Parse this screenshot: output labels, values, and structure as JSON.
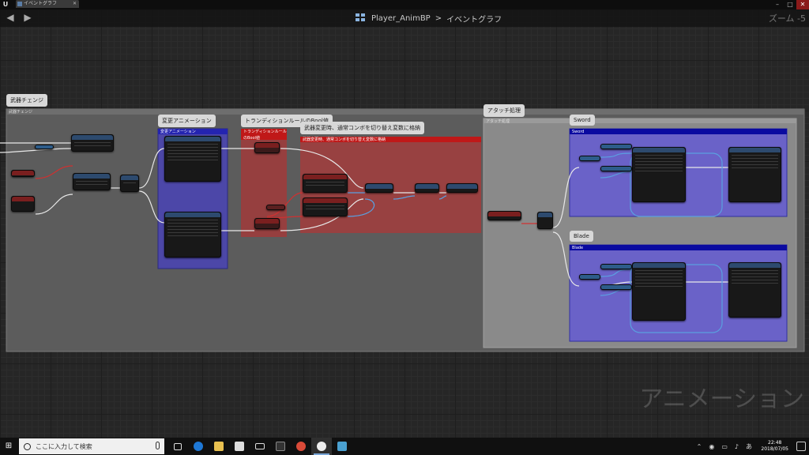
{
  "window": {
    "tab_title": "イベントグラフ"
  },
  "header": {
    "breadcrumb_asset": "Player_AnimBP",
    "breadcrumb_separator": ">",
    "breadcrumb_graph": "イベントグラフ",
    "zoom": "ズーム -5"
  },
  "comments": {
    "outer": {
      "bubble": "武器チェンジ",
      "head": "武器チェンジ"
    },
    "change_anim": {
      "bubble": "変更アニメーション",
      "head": "変更アニメーション"
    },
    "transition": {
      "bubble": "トランディションルールのBool値",
      "head": "トランディションルールのBool値"
    },
    "store": {
      "bubble": "武器変更時、通常コンボを切り替え変数に格納",
      "head": "武器変更時、通常コンボを切り替え変数に格納"
    },
    "attach": {
      "bubble": "アタッチ処理",
      "head": "アタッチ処理"
    },
    "sword": {
      "bubble": "Sword",
      "head": "Sword"
    },
    "blade": {
      "bubble": "Blade",
      "head": "Blade"
    }
  },
  "watermark": "アニメーション",
  "taskbar": {
    "search_placeholder": "ここに入力して検索",
    "time": "22:48",
    "date": "2018/07/05"
  },
  "colors": {
    "purple_comment": "#5a50b0",
    "red_comment": "#b03838",
    "gray_comment": "#5a5a5a",
    "sword_head": "#0a0aa0",
    "exec_wire": "#e8e8e8",
    "blue_wire": "#5aa0e0",
    "red_wire": "#d03030"
  }
}
